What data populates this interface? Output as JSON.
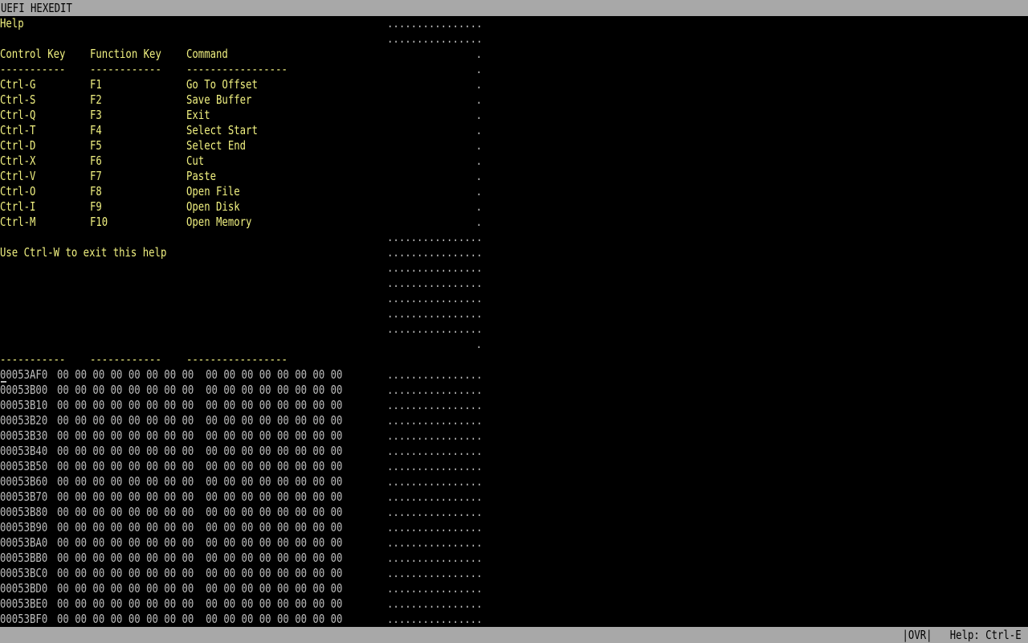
{
  "window": {
    "title": "UEFI HEXEDIT"
  },
  "help": {
    "title": "Help",
    "headers": [
      "Control Key",
      "Function Key",
      "Command"
    ],
    "separators": [
      "-----------",
      "------------",
      "-----------------"
    ],
    "rows": [
      {
        "ctrl": "Ctrl-G",
        "fkey": "F1",
        "cmd": "Go To Offset"
      },
      {
        "ctrl": "Ctrl-S",
        "fkey": "F2",
        "cmd": "Save Buffer"
      },
      {
        "ctrl": "Ctrl-Q",
        "fkey": "F3",
        "cmd": "Exit"
      },
      {
        "ctrl": "Ctrl-T",
        "fkey": "F4",
        "cmd": "Select Start"
      },
      {
        "ctrl": "Ctrl-D",
        "fkey": "F5",
        "cmd": "Select End"
      },
      {
        "ctrl": "Ctrl-X",
        "fkey": "F6",
        "cmd": "Cut"
      },
      {
        "ctrl": "Ctrl-V",
        "fkey": "F7",
        "cmd": "Paste"
      },
      {
        "ctrl": "Ctrl-O",
        "fkey": "F8",
        "cmd": "Open File"
      },
      {
        "ctrl": "Ctrl-I",
        "fkey": "F9",
        "cmd": "Open Disk"
      },
      {
        "ctrl": "Ctrl-M",
        "fkey": "F10",
        "cmd": "Open Memory"
      }
    ],
    "exit_hint": "Use Ctrl-W to exit this help"
  },
  "background_ascii": [
    "................",
    "................",
    ".",
    ".",
    ".",
    ".",
    ".",
    ".",
    ".",
    ".",
    ".",
    ".",
    ".",
    ".",
    "................",
    "................",
    "................",
    "................",
    "................",
    "................",
    "................",
    "."
  ],
  "hexdump": {
    "rows": [
      {
        "offset": "00053AF0",
        "bytes": "00 00 00 00 00 00 00 00  00 00 00 00 00 00 00 00",
        "ascii": "................"
      },
      {
        "offset": "00053B00",
        "bytes": "00 00 00 00 00 00 00 00  00 00 00 00 00 00 00 00",
        "ascii": "................"
      },
      {
        "offset": "00053B10",
        "bytes": "00 00 00 00 00 00 00 00  00 00 00 00 00 00 00 00",
        "ascii": "................"
      },
      {
        "offset": "00053B20",
        "bytes": "00 00 00 00 00 00 00 00  00 00 00 00 00 00 00 00",
        "ascii": "................"
      },
      {
        "offset": "00053B30",
        "bytes": "00 00 00 00 00 00 00 00  00 00 00 00 00 00 00 00",
        "ascii": "................"
      },
      {
        "offset": "00053B40",
        "bytes": "00 00 00 00 00 00 00 00  00 00 00 00 00 00 00 00",
        "ascii": "................"
      },
      {
        "offset": "00053B50",
        "bytes": "00 00 00 00 00 00 00 00  00 00 00 00 00 00 00 00",
        "ascii": "................"
      },
      {
        "offset": "00053B60",
        "bytes": "00 00 00 00 00 00 00 00  00 00 00 00 00 00 00 00",
        "ascii": "................"
      },
      {
        "offset": "00053B70",
        "bytes": "00 00 00 00 00 00 00 00  00 00 00 00 00 00 00 00",
        "ascii": "................"
      },
      {
        "offset": "00053B80",
        "bytes": "00 00 00 00 00 00 00 00  00 00 00 00 00 00 00 00",
        "ascii": "................"
      },
      {
        "offset": "00053B90",
        "bytes": "00 00 00 00 00 00 00 00  00 00 00 00 00 00 00 00",
        "ascii": "................"
      },
      {
        "offset": "00053BA0",
        "bytes": "00 00 00 00 00 00 00 00  00 00 00 00 00 00 00 00",
        "ascii": "................"
      },
      {
        "offset": "00053BB0",
        "bytes": "00 00 00 00 00 00 00 00  00 00 00 00 00 00 00 00",
        "ascii": "................"
      },
      {
        "offset": "00053BC0",
        "bytes": "00 00 00 00 00 00 00 00  00 00 00 00 00 00 00 00",
        "ascii": "................"
      },
      {
        "offset": "00053BD0",
        "bytes": "00 00 00 00 00 00 00 00  00 00 00 00 00 00 00 00",
        "ascii": "................"
      },
      {
        "offset": "00053BE0",
        "bytes": "00 00 00 00 00 00 00 00  00 00 00 00 00 00 00 00",
        "ascii": "................"
      },
      {
        "offset": "00053BF0",
        "bytes": "00 00 00 00 00 00 00 00  00 00 00 00 00 00 00 00",
        "ascii": "................"
      }
    ]
  },
  "status": {
    "text": "|OVR|   Help: Ctrl-E"
  },
  "colors": {
    "bar_bg": "#a8a8a8",
    "help_text": "#f0f080",
    "hex_text": "#bcbcbc",
    "background": "#000000"
  }
}
